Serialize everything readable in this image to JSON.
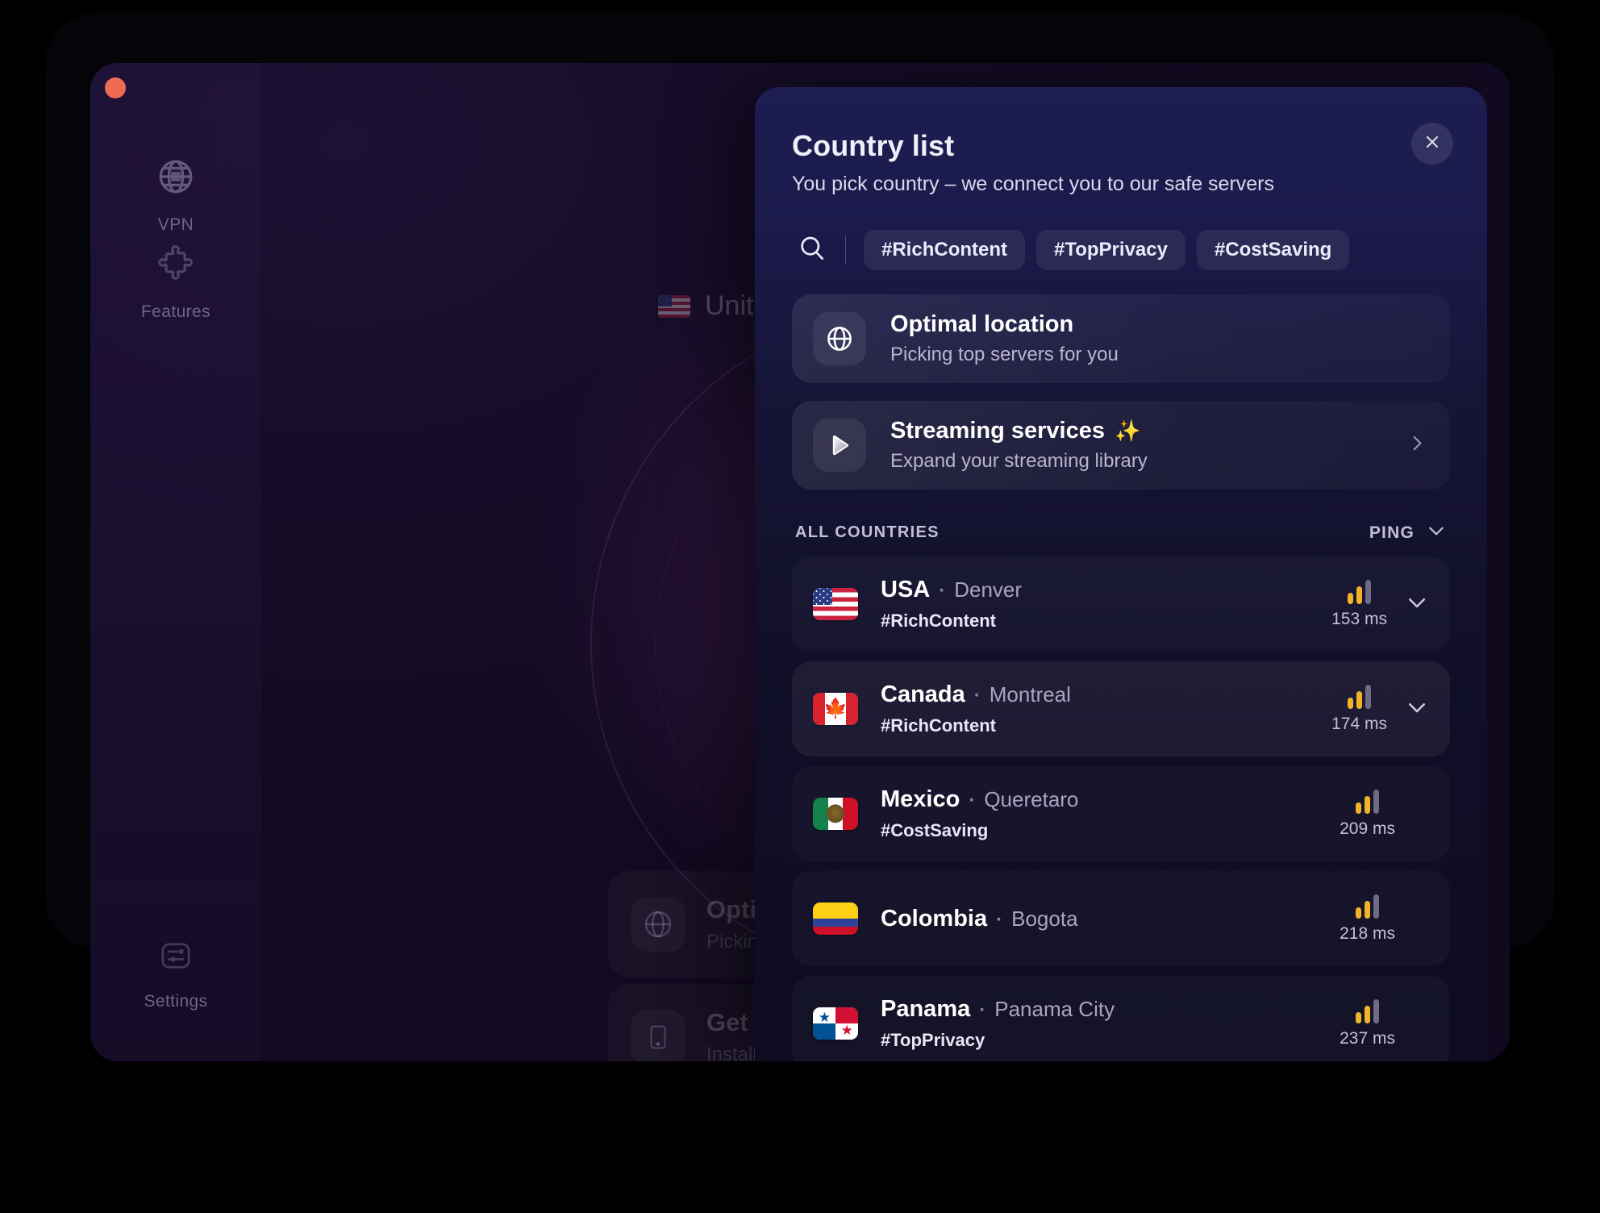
{
  "window": {
    "traffic_light_color": "#ef6b56"
  },
  "sidebar": {
    "items": [
      {
        "label": "VPN",
        "icon": "globe-icon"
      },
      {
        "label": "Features",
        "icon": "puzzle-piece-icon"
      },
      {
        "label": "Settings",
        "icon": "sliders-icon"
      }
    ]
  },
  "background": {
    "connection_label": "United States",
    "connection_flag": "us-flag-icon",
    "cards": [
      {
        "title": "Optimal location",
        "subtitle": "Picking top servers for you",
        "icon": "globe-icon"
      },
      {
        "title": "Get ClearVPN on mobile",
        "subtitle": "Install app on your phone",
        "icon": "phone-icon"
      }
    ]
  },
  "panel": {
    "title": "Country list",
    "subtitle": "You pick country – we connect you to our safe servers",
    "close_icon": "close-icon",
    "search": {
      "icon": "search-icon",
      "placeholder": "Search"
    },
    "tags": [
      "#RichContent",
      "#TopPrivacy",
      "#CostSaving"
    ],
    "featured": [
      {
        "title": "Optimal location",
        "subtitle": "Picking top servers for you",
        "icon": "globe-icon",
        "badge": "",
        "has_chevron": false
      },
      {
        "title": "Streaming services",
        "subtitle": "Expand your streaming library",
        "icon": "play-icon",
        "badge": "✨",
        "has_chevron": true
      }
    ],
    "section": {
      "title": "ALL COUNTRIES",
      "sort_label": "PING",
      "sort_icon": "chevron-down-icon"
    },
    "countries": [
      {
        "name": "USA",
        "city": "Denver",
        "tag": "#RichContent",
        "ping": "153 ms",
        "flag": "us-flag-icon",
        "expandable": true,
        "highlight": false
      },
      {
        "name": "Canada",
        "city": "Montreal",
        "tag": "#RichContent",
        "ping": "174 ms",
        "flag": "ca-flag-icon",
        "expandable": true,
        "highlight": true
      },
      {
        "name": "Mexico",
        "city": "Queretaro",
        "tag": "#CostSaving",
        "ping": "209 ms",
        "flag": "mx-flag-icon",
        "expandable": false,
        "highlight": false
      },
      {
        "name": "Colombia",
        "city": "Bogota",
        "tag": "",
        "ping": "218 ms",
        "flag": "co-flag-icon",
        "expandable": false,
        "highlight": false
      },
      {
        "name": "Panama",
        "city": "Panama City",
        "tag": "#TopPrivacy",
        "ping": "237 ms",
        "flag": "pa-flag-icon",
        "expandable": false,
        "highlight": false
      }
    ],
    "signal": {
      "active_color": "#f0b429",
      "inactive_color": "#6f6b86",
      "bars_active": 2,
      "bars_total": 3
    }
  },
  "theme": {
    "panel_top": "#1d1d52",
    "panel_bottom": "#0d0c20",
    "app_bg": "#130b22",
    "accent": "#f0b429",
    "text_primary": "#ffffff",
    "text_muted": "#a9a4c0"
  }
}
